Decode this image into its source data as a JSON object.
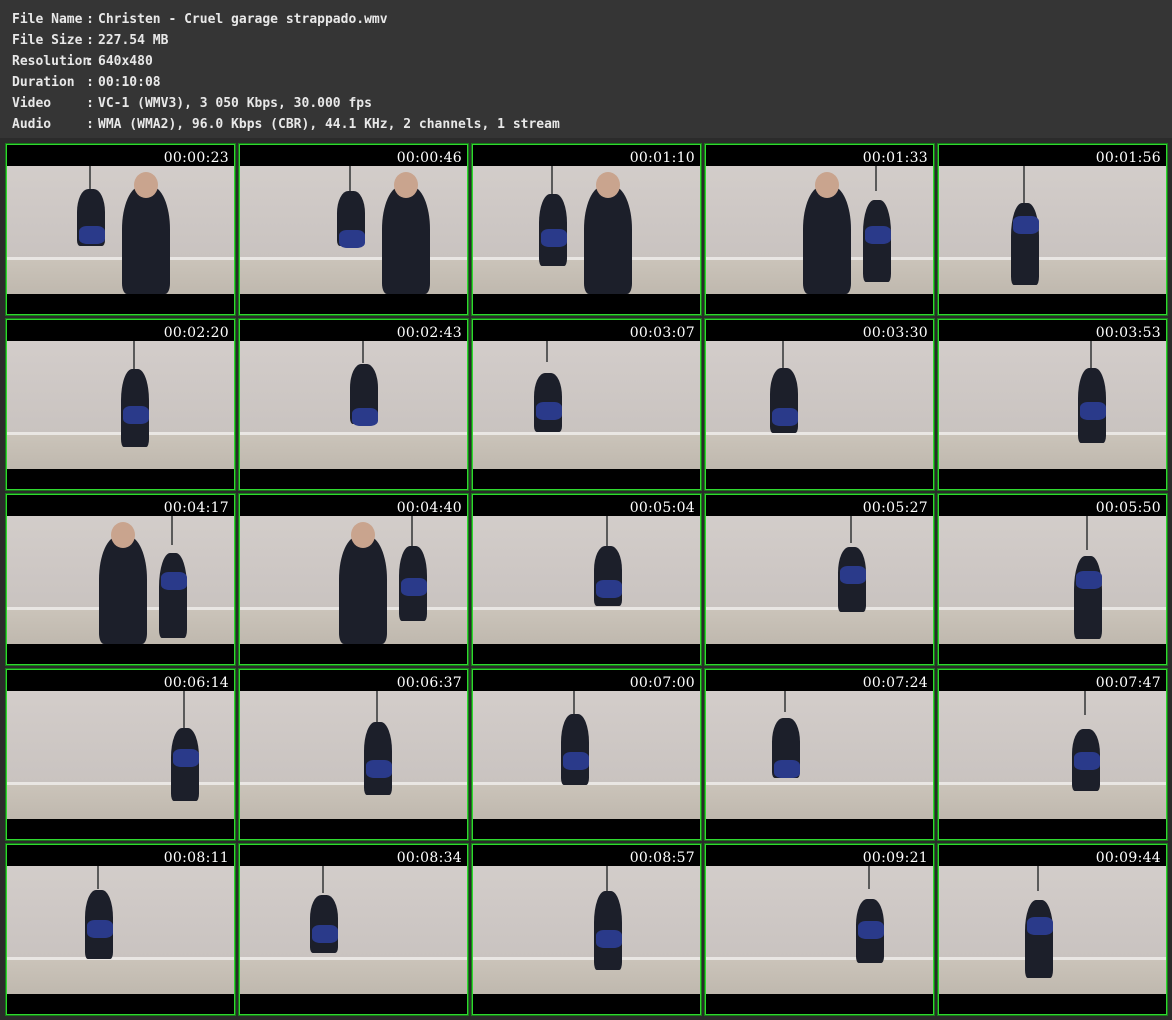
{
  "info": {
    "rows": [
      {
        "label": "File Name",
        "value": "Christen - Cruel garage strappado.wmv"
      },
      {
        "label": "File Size",
        "value": "227.54 MB"
      },
      {
        "label": "Resolution",
        "value": "640x480"
      },
      {
        "label": "Duration",
        "value": "00:10:08"
      },
      {
        "label": "Video",
        "value": "VC-1 (WMV3), 3 050 Kbps, 30.000 fps"
      },
      {
        "label": "Audio",
        "value": "WMA (WMA2), 96.0 Kbps (CBR), 44.1 KHz, 2 channels, 1 stream"
      }
    ],
    "colon": ":"
  },
  "thumbnails": [
    "00:00:23",
    "00:00:46",
    "00:01:10",
    "00:01:33",
    "00:01:56",
    "00:02:20",
    "00:02:43",
    "00:03:07",
    "00:03:30",
    "00:03:53",
    "00:04:17",
    "00:04:40",
    "00:05:04",
    "00:05:27",
    "00:05:50",
    "00:06:14",
    "00:06:37",
    "00:07:00",
    "00:07:24",
    "00:07:47",
    "00:08:11",
    "00:08:34",
    "00:08:57",
    "00:09:21",
    "00:09:44"
  ],
  "colors": {
    "border": "#2fd82f",
    "wall": "#c9c3c0",
    "floor": "#bfb8ae",
    "figure_dark": "#1c1f2a",
    "figure_blue": "#2a3a8a",
    "skin": "#c9a48e"
  }
}
